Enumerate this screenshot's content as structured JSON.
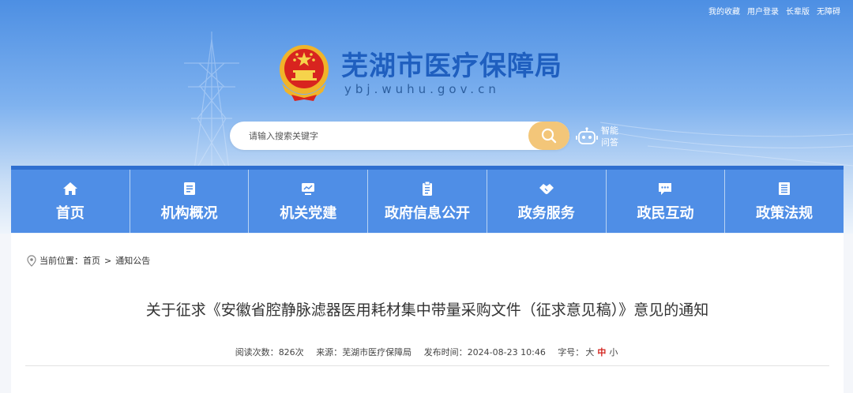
{
  "toplinks": [
    "我的收藏",
    "用户登录",
    "长辈版",
    "无障碍"
  ],
  "site": {
    "title": "芜湖市医疗保障局",
    "domain": "ybj.wuhu.gov.cn"
  },
  "search": {
    "placeholder": "请输入搜索关键字",
    "value": ""
  },
  "assistant": {
    "label": "智能问答"
  },
  "nav": [
    {
      "label": "首页",
      "icon": "home-icon"
    },
    {
      "label": "机构概况",
      "icon": "document-icon"
    },
    {
      "label": "机关党建",
      "icon": "monitor-icon"
    },
    {
      "label": "政府信息公开",
      "icon": "clipboard-icon"
    },
    {
      "label": "政务服务",
      "icon": "handshake-icon"
    },
    {
      "label": "政民互动",
      "icon": "chat-icon"
    },
    {
      "label": "政策法规",
      "icon": "book-icon"
    }
  ],
  "breadcrumb": {
    "prefix": "当前位置：",
    "items": [
      "首页",
      "通知公告"
    ],
    "separator": ">"
  },
  "article": {
    "title": "关于征求《安徽省腔静脉滤器医用耗材集中带量采购文件（征求意见稿）》意见的通知",
    "views_label": "阅读次数：",
    "views": "826次",
    "source_label": "来源：",
    "source": "芜湖市医疗保障局",
    "date_label": "发布时间：",
    "date": "2024-08-23 10:46",
    "fontsize_label": "字号：",
    "fontsize_options": [
      "大",
      "中",
      "小"
    ]
  },
  "colors": {
    "nav_bg": "#4f8ee6",
    "nav_border": "#2e6fd0",
    "title_blue": "#1f5fbf",
    "search_btn": "#f3c679",
    "accent_red": "#d2231d"
  }
}
